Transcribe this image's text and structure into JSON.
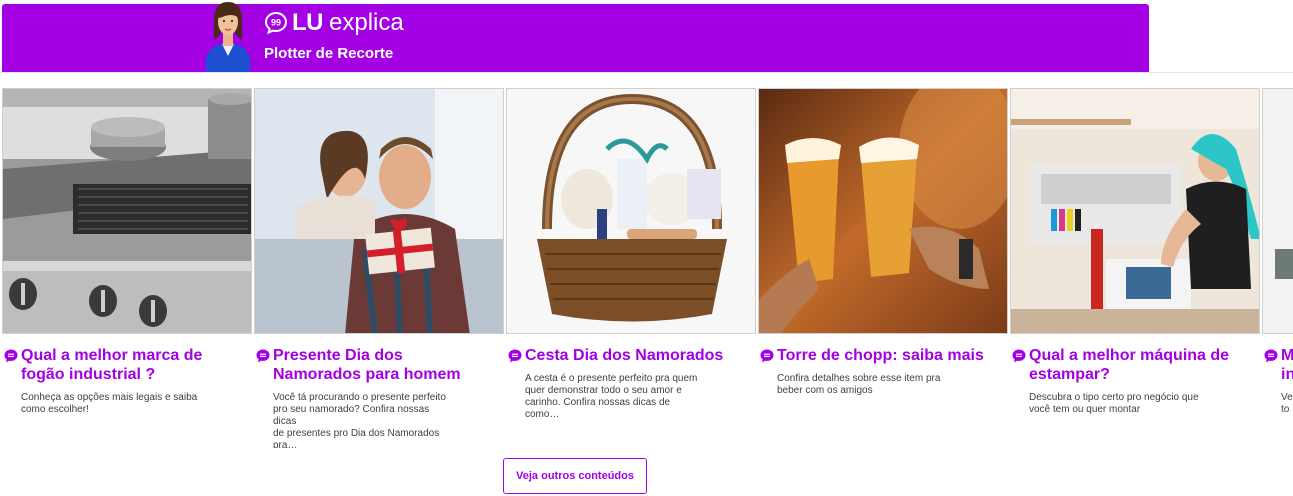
{
  "banner": {
    "brand_lu": "LU",
    "brand_word": "explica",
    "subtitle": "Plotter de Recorte",
    "color": "#a400e4"
  },
  "cards": [
    {
      "title_l1": "Qual a melhor marca de",
      "title_l2": "fogão industrial ?",
      "desc_l1": "Conheça as opções mais legais e saiba",
      "desc_l2": "como escolher!",
      "desc_l3": "",
      "image": "industrial-stove-photo"
    },
    {
      "title_l1": "Presente Dia dos",
      "title_l2": "Namorados para homem",
      "desc_l1": "Você tá procurando o presente perfeito",
      "desc_l2": "pro seu namorado? Confira nossas dicas",
      "desc_l3": "de presentes pro Dia dos Namorados pra…",
      "image": "couple-gift-photo"
    },
    {
      "title_l1": "Cesta Dia dos Namorados",
      "title_l2": "",
      "desc_l1": "A cesta é o presente perfeito pra quem",
      "desc_l2": "quer demonstrar todo o seu amor e",
      "desc_l3": "carinho. Confira nossas dicas de como…",
      "image": "gift-basket-photo"
    },
    {
      "title_l1": "Torre de chopp: saiba mais",
      "title_l2": "",
      "desc_l1": "Confira detalhes sobre esse item pra",
      "desc_l2": "beber com os amigos",
      "desc_l3": "",
      "image": "beer-toast-photo"
    },
    {
      "title_l1": "Qual a melhor máquina de",
      "title_l2": "estampar?",
      "desc_l1": "Descubra o tipo certo pro negócio que",
      "desc_l2": "você tem ou quer montar",
      "desc_l3": "",
      "image": "printing-machine-photo"
    },
    {
      "title_l1": "M",
      "title_l2": "in",
      "desc_l1": "Ve",
      "desc_l2": "to",
      "desc_l3": "",
      "image": "partial-photo"
    }
  ],
  "more_button": {
    "label": "Veja outros conteúdos"
  }
}
